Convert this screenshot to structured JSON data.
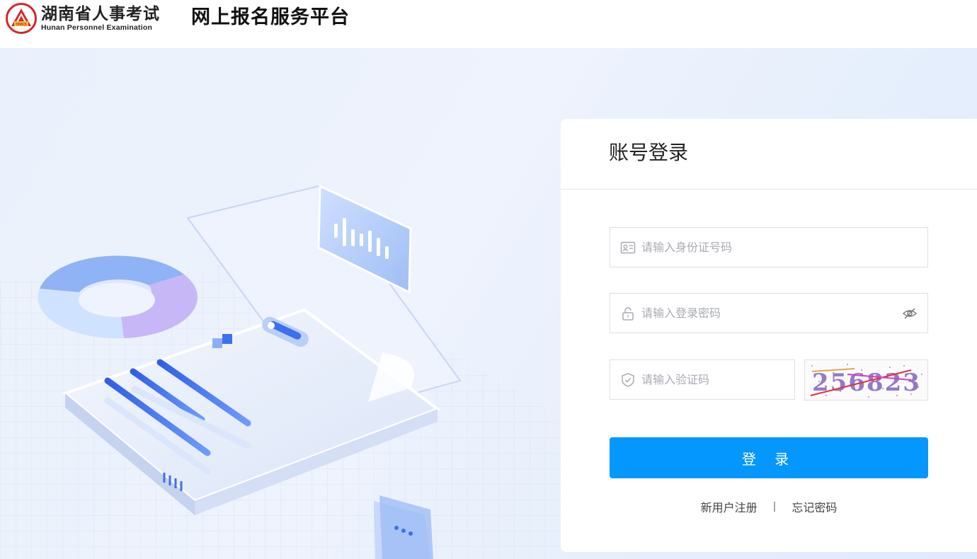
{
  "header": {
    "logo_cn": "湖南省人事考试",
    "logo_en": "Hunan Personnel Examination",
    "logo_badge": "HNKS",
    "platform_title": "网上报名服务平台"
  },
  "login": {
    "title": "账号登录",
    "id_field": {
      "placeholder": "请输入身份证号码",
      "icon": "id-card-icon"
    },
    "password_field": {
      "placeholder": "请输入登录密码",
      "icon": "lock-icon",
      "toggle_icon": "eye-off-icon"
    },
    "captcha_field": {
      "placeholder": "请输入验证码",
      "icon": "shield-icon"
    },
    "captcha_text": "256823",
    "login_button": "登 录",
    "register_link": "新用户注册",
    "separator": "|",
    "forgot_link": "忘记密码"
  },
  "colors": {
    "brand_red": "#d4262b",
    "primary_blue": "#0497fe"
  }
}
